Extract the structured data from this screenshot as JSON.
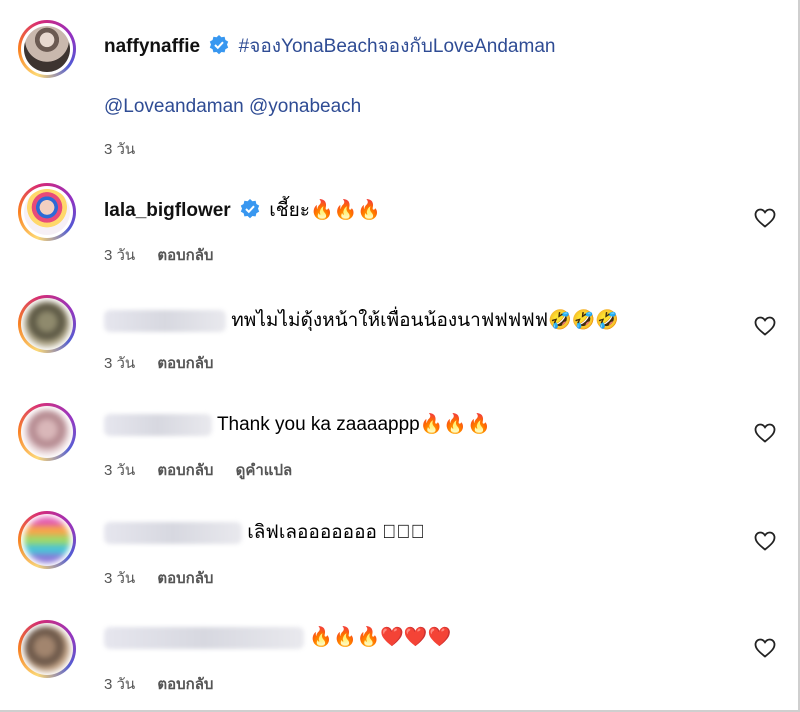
{
  "post": {
    "username": "naffynaffie",
    "hashtag": "#จองYonaBeachจองกับLoveAndaman",
    "mentions": "@Loveandaman @yonabeach",
    "time": "3 วัน"
  },
  "comments": [
    {
      "username": "lala_bigflower",
      "text": "เชี้ยะ🔥🔥🔥",
      "time": "3 วัน",
      "reply": "ตอบกลับ",
      "translate": ""
    },
    {
      "username": "",
      "text": "ทพไมไม่ดุ้งหน้าให้เพื่อนน้องนาฟฟฟฟฟ🤣🤣🤣",
      "time": "3 วัน",
      "reply": "ตอบกลับ",
      "translate": ""
    },
    {
      "username": "",
      "text": "Thank you ka zaaaappp🔥🔥🔥",
      "time": "3 วัน",
      "reply": "ตอบกลับ",
      "translate": "ดูคำแปล"
    },
    {
      "username": "",
      "text": "เลิฟเลอออออออ 􀀀􀀀􀀀",
      "time": "3 วัน",
      "reply": "ตอบกลับ",
      "translate": ""
    },
    {
      "username": "",
      "text": "🔥🔥🔥❤️❤️❤️",
      "time": "3 วัน",
      "reply": "ตอบกลับ",
      "translate": ""
    }
  ],
  "icons": {
    "verified_color": "#3897f0",
    "heart_icon": "heart-outline-icon"
  }
}
